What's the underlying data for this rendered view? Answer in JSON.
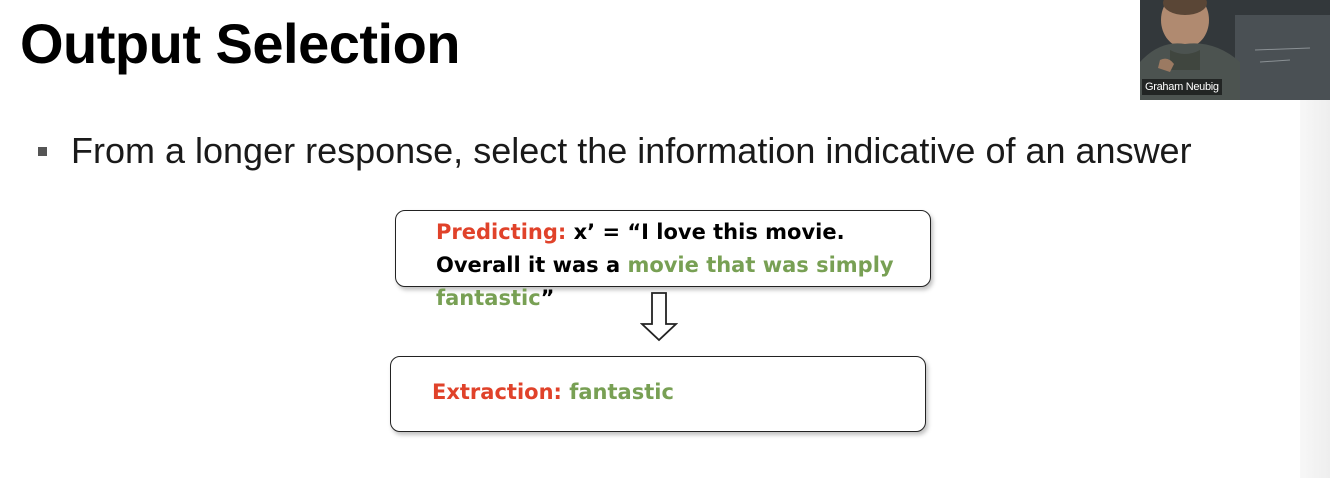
{
  "slide": {
    "title": "Output Selection",
    "bullet": "From a longer response, select the information indicative of an answer"
  },
  "prediction_box": {
    "label": "Predicting:",
    "text_before": "x’ = “I love this movie. Overall it was a ",
    "highlight": "movie that was simply fantastic",
    "text_after": "”"
  },
  "extraction_box": {
    "label": "Extraction:",
    "value": "fantastic"
  },
  "video": {
    "participant_name": "Graham Neubig"
  },
  "colors": {
    "label_red": "#e0422a",
    "highlight_green": "#78a054"
  },
  "icons": {
    "arrow": "down-arrow-icon",
    "bullet": "square-bullet-icon"
  }
}
